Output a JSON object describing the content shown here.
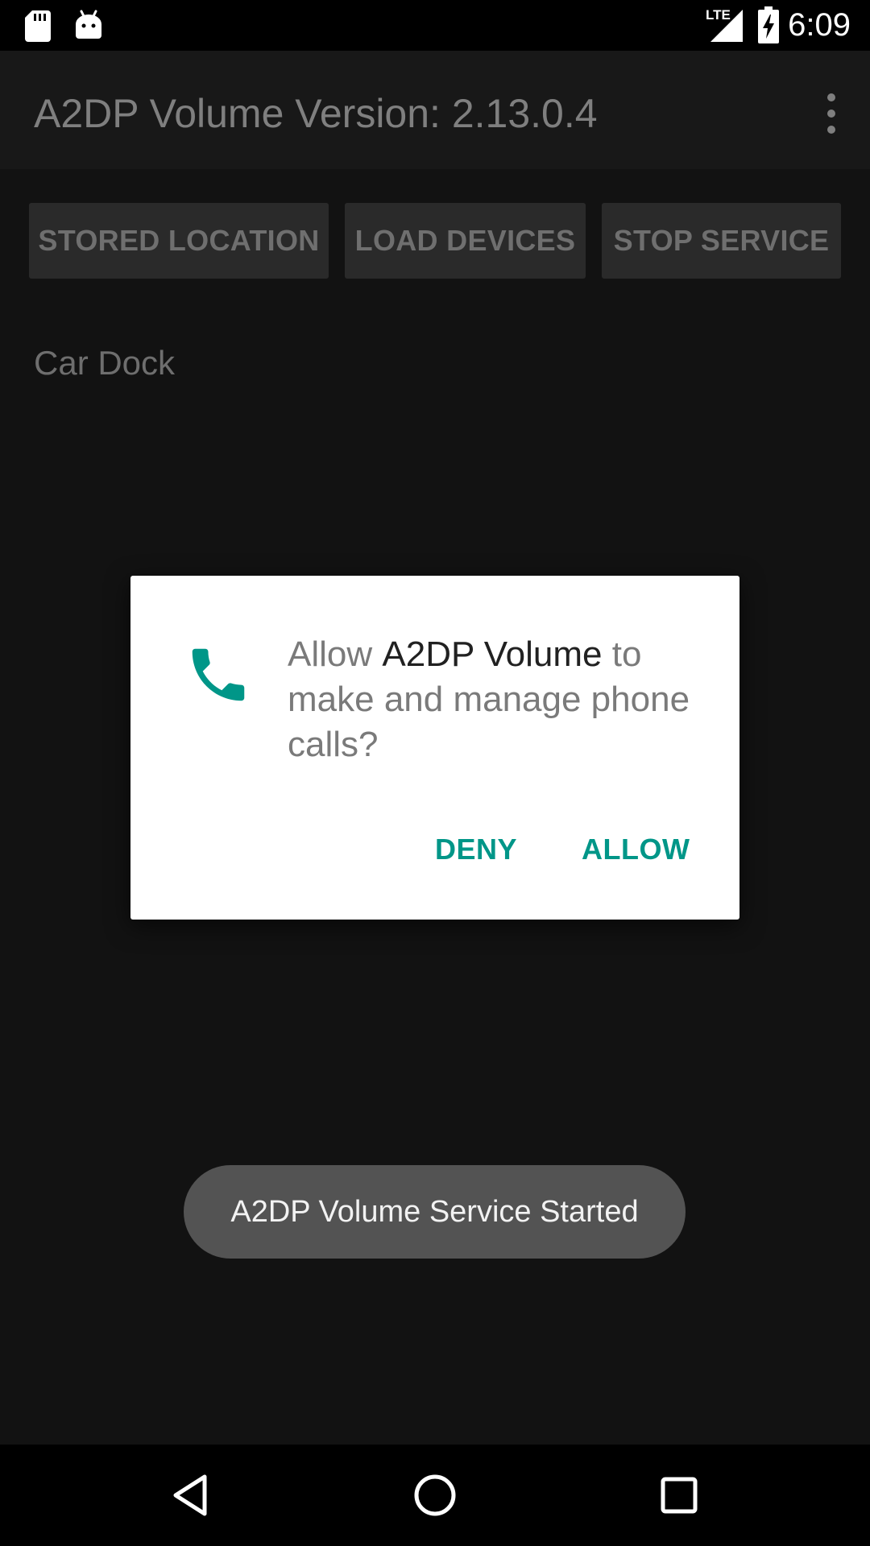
{
  "status_bar": {
    "time": "6:09",
    "network_label": "LTE",
    "icons": [
      "sd-card-icon",
      "android-debug-icon",
      "lte-signal-icon",
      "battery-charging-icon"
    ]
  },
  "app_bar": {
    "title": "A2DP Volume Version: 2.13.0.4",
    "menu_icon": "more-vert-icon"
  },
  "buttons": {
    "stored_location": "STORED LOCATION",
    "load_devices": "LOAD DEVICES",
    "stop_service": "STOP SERVICE"
  },
  "devices": [
    "Car Dock"
  ],
  "permission_dialog": {
    "icon": "phone-icon",
    "prefix": "Allow ",
    "app_name": "A2DP Volume",
    "suffix": " to make and manage phone calls?",
    "deny_label": "DENY",
    "allow_label": "ALLOW",
    "accent_color": "#009688"
  },
  "toast": {
    "message": "A2DP Volume Service Started"
  },
  "nav_bar": {
    "icons": [
      "back-icon",
      "home-icon",
      "recents-icon"
    ]
  }
}
